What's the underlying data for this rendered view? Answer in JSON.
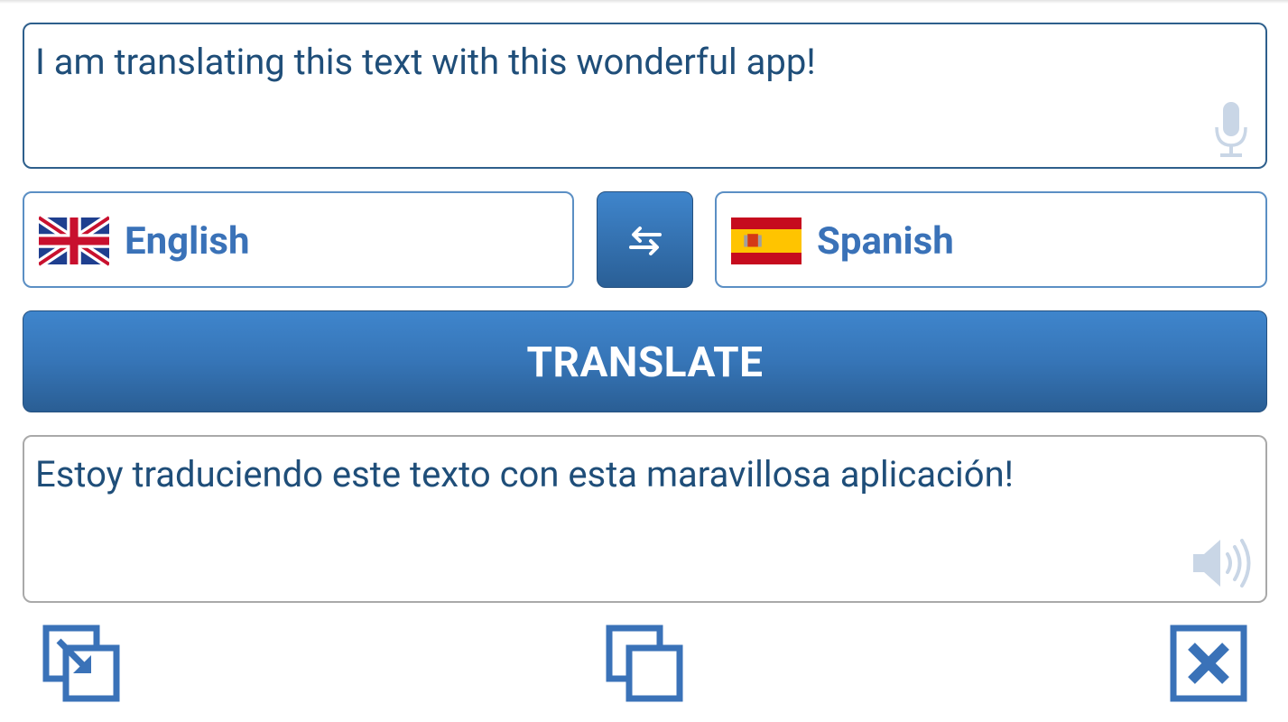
{
  "input": {
    "text": "I am translating this text with this wonderful app!"
  },
  "languages": {
    "source": {
      "label": "English",
      "flag": "uk-flag-icon"
    },
    "target": {
      "label": "Spanish",
      "flag": "spain-flag-icon"
    }
  },
  "actions": {
    "translate_label": "TRANSLATE"
  },
  "output": {
    "text": "Estoy traduciendo este texto con esta maravillosa aplicación!"
  },
  "icons": {
    "mic": "microphone-icon",
    "speaker": "speaker-icon",
    "swap": "swap-arrows-icon",
    "paste": "paste-icon",
    "copy": "copy-icon",
    "clear": "clear-icon"
  },
  "colors": {
    "accent": "#3a72b8",
    "button_top": "#3f85cc",
    "button_bottom": "#2a5e94",
    "text": "#1f4e79"
  }
}
